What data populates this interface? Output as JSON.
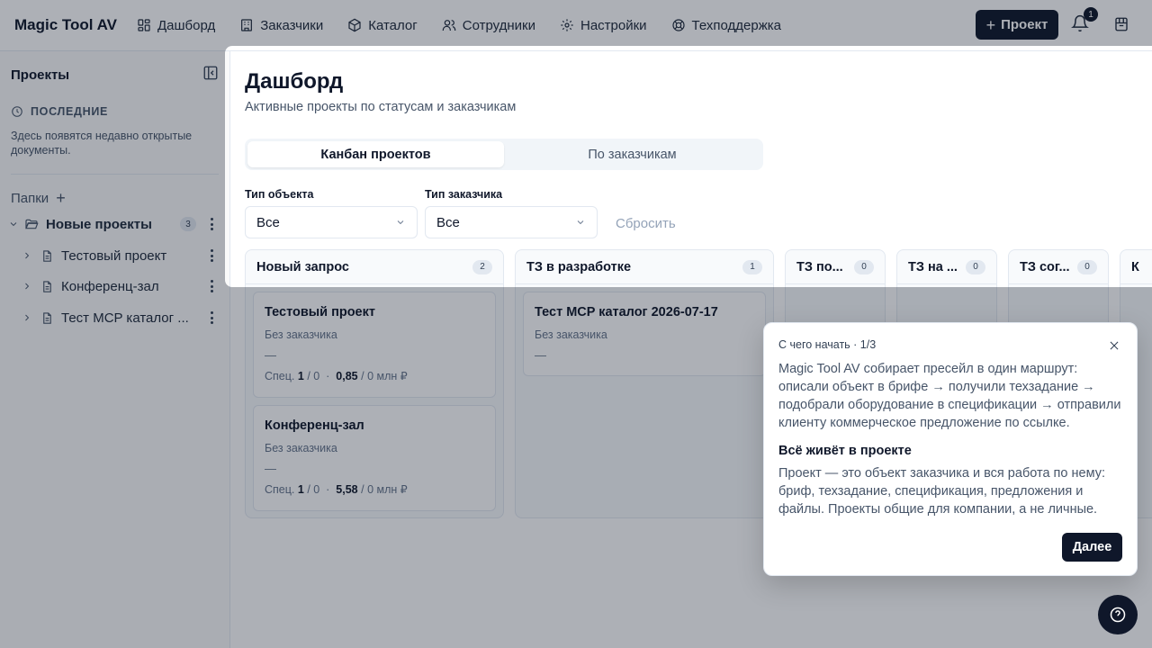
{
  "app": {
    "title": "Magic Tool AV"
  },
  "nav": [
    {
      "label": "Дашборд",
      "icon": "dashboard-icon"
    },
    {
      "label": "Заказчики",
      "icon": "building-icon"
    },
    {
      "label": "Каталог",
      "icon": "box-icon"
    },
    {
      "label": "Сотрудники",
      "icon": "users-icon"
    },
    {
      "label": "Настройки",
      "icon": "gear-icon"
    },
    {
      "label": "Техподдержка",
      "icon": "lifebuoy-icon"
    }
  ],
  "header": {
    "project_button": "Проект",
    "notifications_count": "1"
  },
  "sidebar": {
    "title": "Проекты",
    "recent_label": "ПОСЛЕДНИЕ",
    "recent_empty": "Здесь появятся недавно открытые документы.",
    "folders_label": "Папки",
    "folder": {
      "name": "Новые проекты",
      "count": "3"
    },
    "items": [
      {
        "name": "Тестовый проект"
      },
      {
        "name": "Конференц-зал"
      },
      {
        "name": "Тест MCP каталог ..."
      }
    ]
  },
  "main": {
    "title": "Дашборд",
    "subtitle": "Активные проекты по статусам и заказчикам",
    "tabs": [
      {
        "label": "Канбан проектов"
      },
      {
        "label": "По заказчикам"
      }
    ],
    "filters": {
      "object_type_label": "Тип объекта",
      "object_type_value": "Все",
      "customer_type_label": "Тип заказчика",
      "customer_type_value": "Все",
      "reset": "Сбросить"
    },
    "columns": [
      {
        "title": "Новый запрос",
        "count": "2"
      },
      {
        "title": "ТЗ в разработке",
        "count": "1"
      },
      {
        "title": "ТЗ по...",
        "count": "0"
      },
      {
        "title": "ТЗ на ...",
        "count": "0"
      },
      {
        "title": "ТЗ сог...",
        "count": "0"
      },
      {
        "title": "К",
        "count": ""
      }
    ],
    "cards": [
      {
        "title": "Тестовый проект",
        "customer": "Без заказчика",
        "dash": "—",
        "spec_prefix": "Спец.",
        "spec_count": "1",
        "spec_rest": "/ 0",
        "sep": "·",
        "amount": "0,85",
        "amount_rest": "/ 0 млн ₽"
      },
      {
        "title": "Конференц-зал",
        "customer": "Без заказчика",
        "dash": "—",
        "spec_prefix": "Спец.",
        "spec_count": "1",
        "spec_rest": "/ 0",
        "sep": "·",
        "amount": "5,58",
        "amount_rest": "/ 0 млн ₽"
      },
      {
        "title": "Тест MCP каталог 2026-07-17",
        "customer": "Без заказчика",
        "dash": "—"
      }
    ]
  },
  "tour": {
    "step": "С чего начать · 1/3",
    "body": "Magic Tool AV собирает пресейл в один маршрут: описали объект в брифе → получили техзадание → подобрали оборудование в спецификации → отправили клиенту коммерческое предложение по ссылке.",
    "heading": "Всё живёт в проекте",
    "body2": "Проект — это объект заказчика и вся работа по нему: бриф, техзадание, спецификация, предложения и файлы. Проекты общие для компании, а не личные.",
    "next": "Далее"
  },
  "colors": {
    "primary": "#0f172a",
    "muted": "#475569",
    "border": "#e2e8f0"
  }
}
